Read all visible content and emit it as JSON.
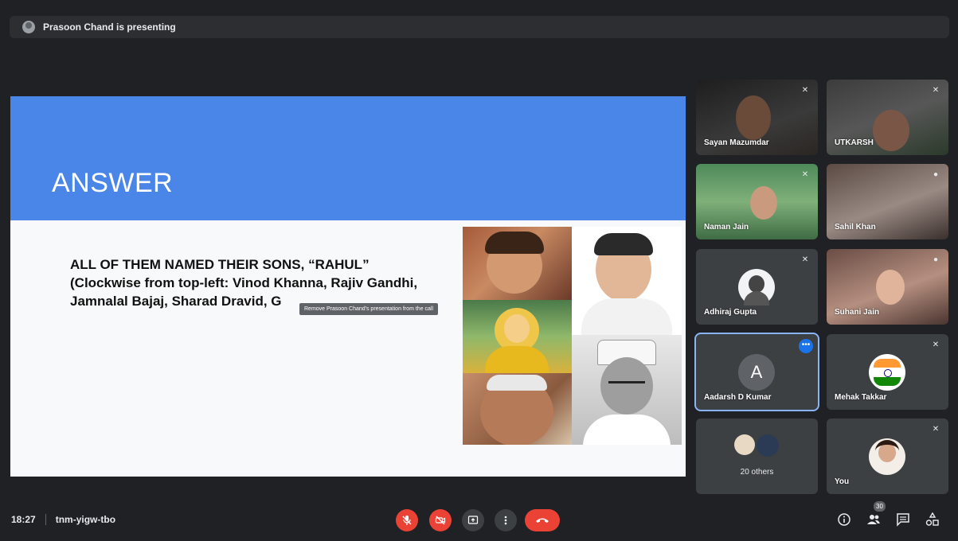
{
  "presenting_banner": "Prasoon Chand is presenting",
  "slide": {
    "title": "ANSWER",
    "body": "ALL OF THEM NAMED THEIR SONS, “RAHUL”\n(Clockwise from top-left: Vinod Khanna, Rajiv Gandhi,\nJamnalal Bajaj, Sharad Dravid, G",
    "tooltip": "Remove Prasoon Chand's presentation from the call"
  },
  "participants": [
    {
      "name": "Sayan Mazumdar",
      "muted": true
    },
    {
      "name": "UTKARSH",
      "muted": true
    },
    {
      "name": "Naman Jain",
      "muted": true
    },
    {
      "name": "Sahil Khan",
      "muted": false
    },
    {
      "name": "Adhiraj Gupta",
      "muted": true
    },
    {
      "name": "Suhani Jain",
      "muted": false
    },
    {
      "name": "Aadarsh D Kumar",
      "avatar_letter": "A",
      "selected": true
    },
    {
      "name": "Mehak Takkar",
      "muted": true
    },
    {
      "name": "20 others"
    },
    {
      "name": "You",
      "muted": true
    }
  ],
  "bottom": {
    "time": "18:27",
    "meeting_code": "tnm-yigw-tbo",
    "participant_count": "30"
  },
  "colors": {
    "accent_red": "#ea4335",
    "slide_blue": "#4a86e8",
    "selected_outline": "#8ab4f8"
  },
  "icons": [
    "mic-off-icon",
    "camera-off-icon",
    "present-icon",
    "more-icon",
    "end-call-icon",
    "info-icon",
    "people-icon",
    "chat-icon",
    "activities-icon"
  ]
}
